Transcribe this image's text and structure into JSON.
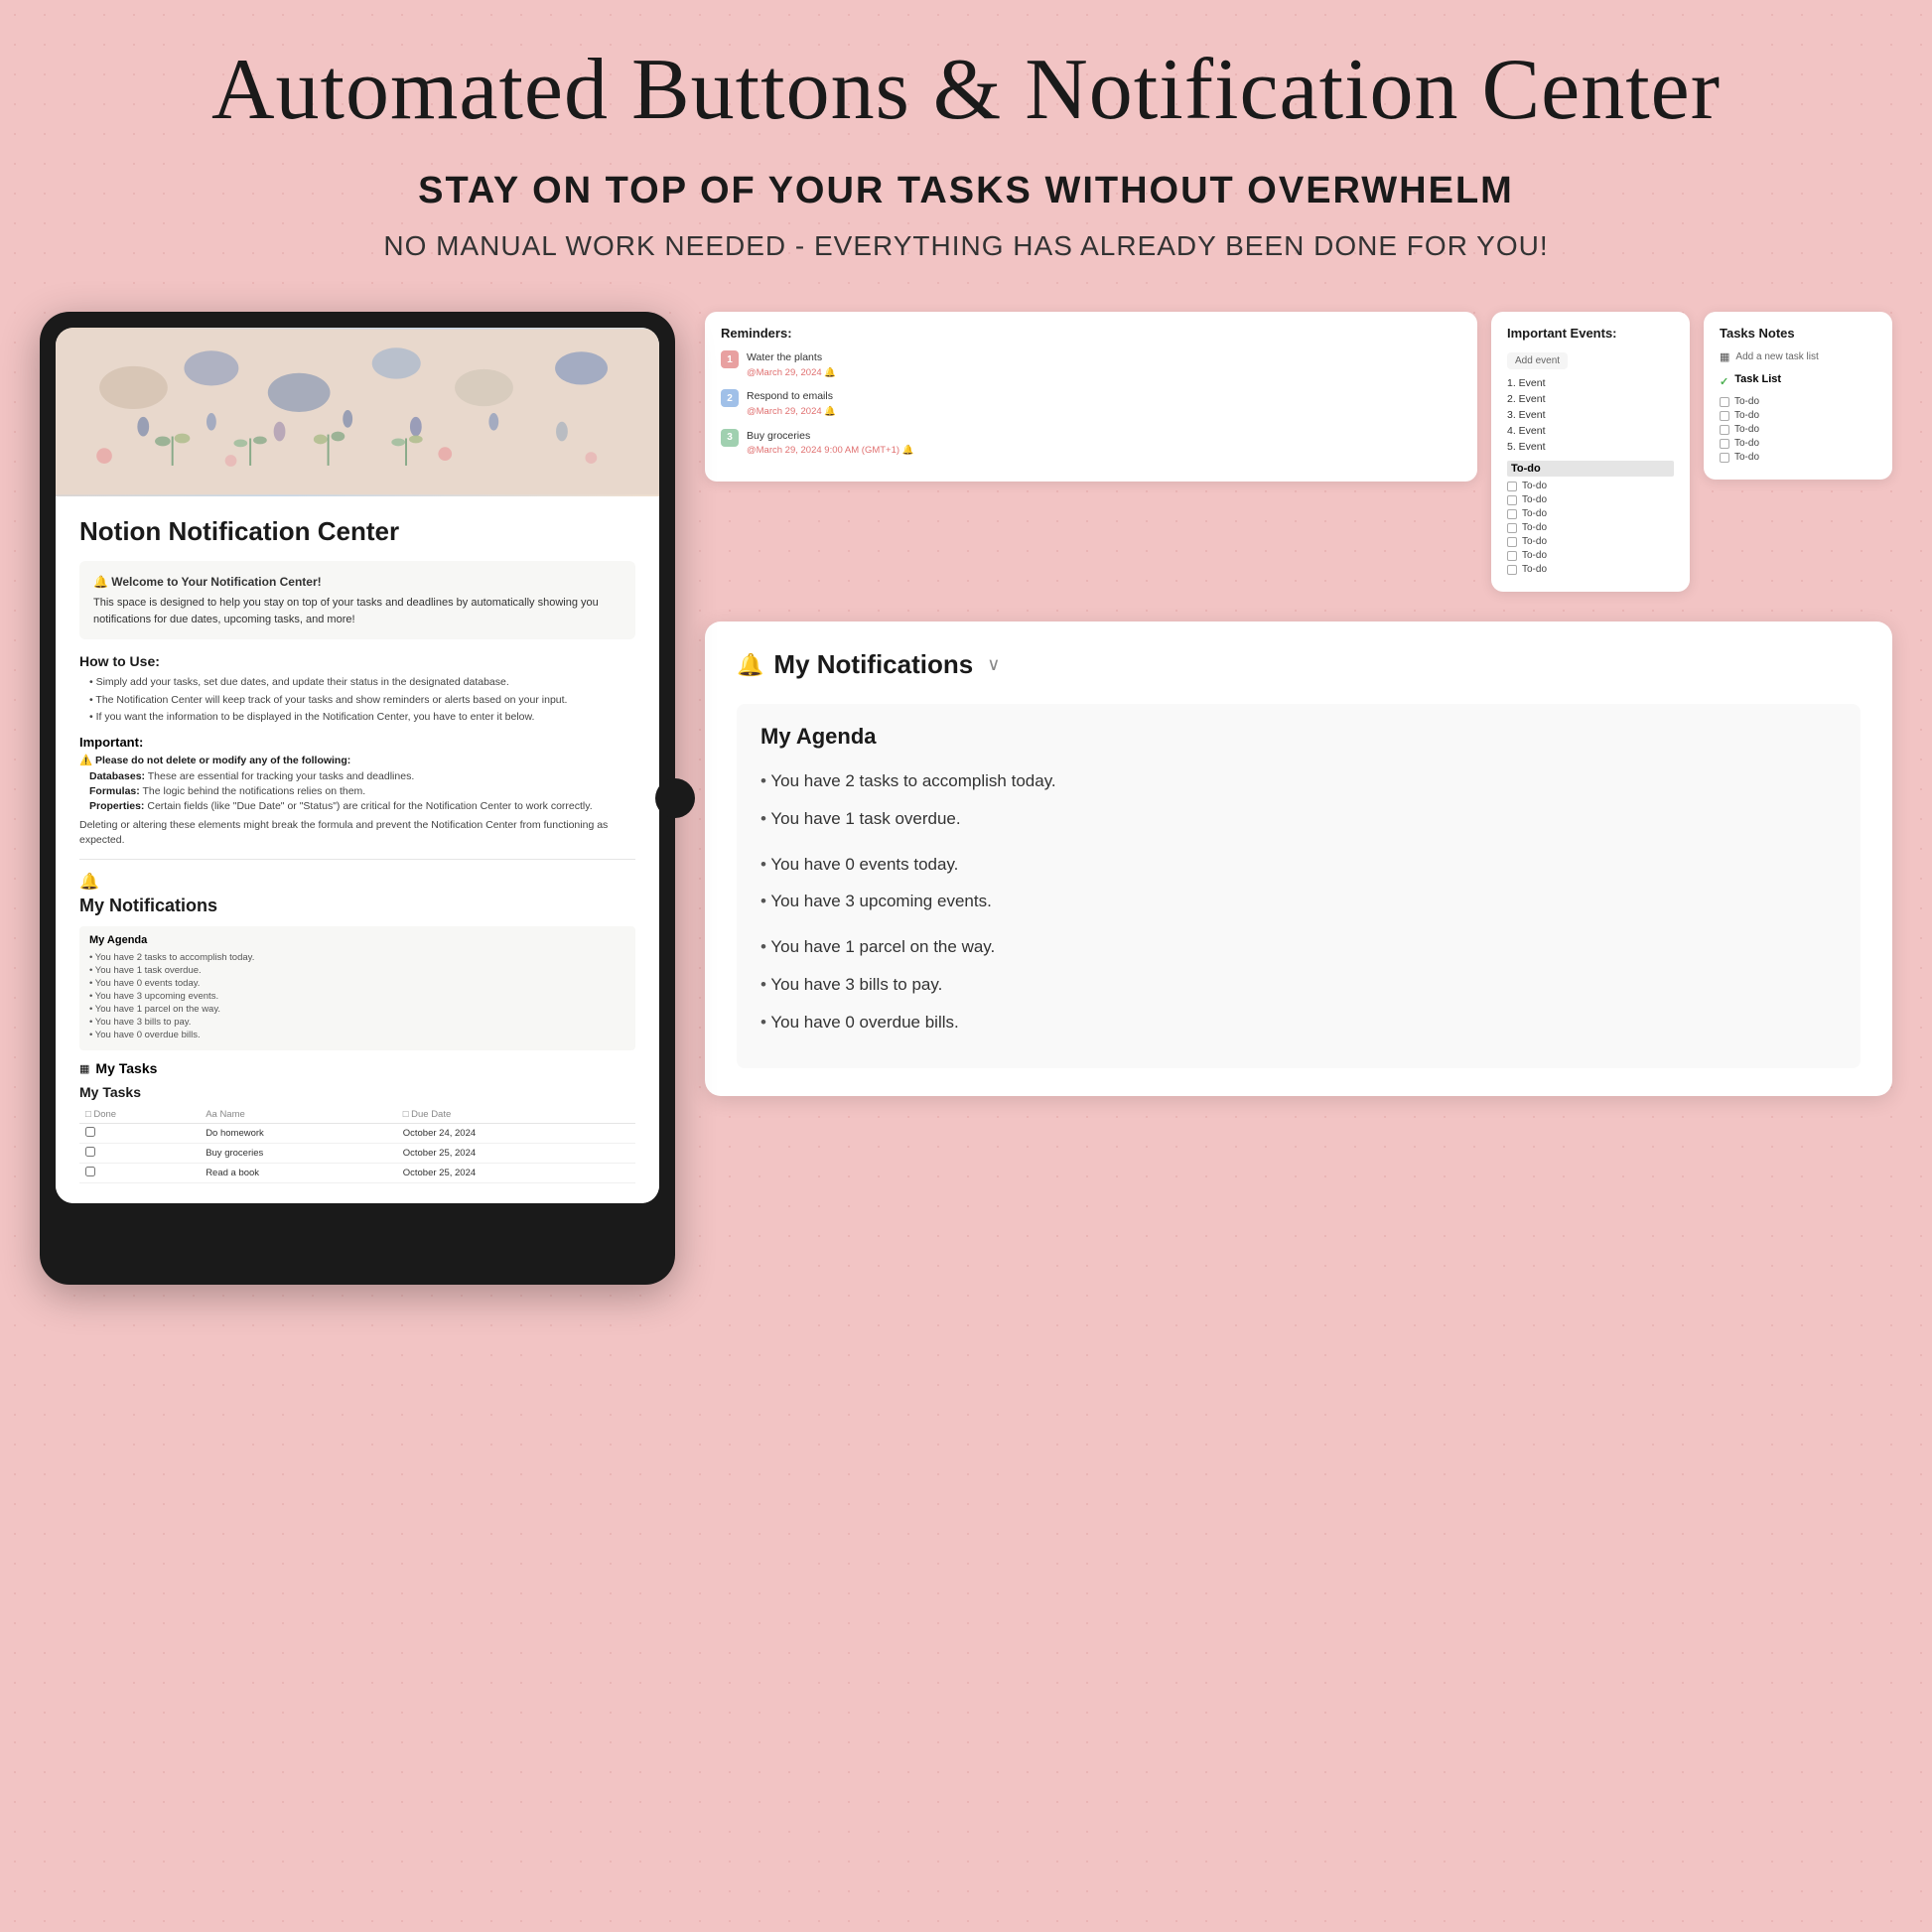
{
  "page": {
    "title": "Automated Buttons & Notification Center",
    "subtitle1": "STAY ON TOP OF YOUR TASKS WITHOUT OVERWHELM",
    "subtitle2": "NO MANUAL WORK NEEDED - EVERYTHING HAS ALREADY BEEN DONE FOR YOU!"
  },
  "tablet": {
    "notion_title": "Notion Notification Center",
    "welcome_title": "🔔 Welcome to Your Notification Center!",
    "welcome_body": "This space is designed to help you stay on top of your tasks and deadlines by automatically showing you notifications for due dates, upcoming tasks, and more!",
    "how_to_use": "How to Use:",
    "bullets": [
      "Simply add your tasks, set due dates, and update their status in the designated database.",
      "The Notification Center will keep track of your tasks and show reminders or alerts based on your input.",
      "If you want the information to be displayed in the Notification Center, you have to enter it below."
    ],
    "important": "Important:",
    "warning": "⚠️ Please do not delete or modify any of the following:",
    "bold_bullets": [
      {
        "bold": "Databases:",
        "text": " These are essential for tracking your tasks and deadlines."
      },
      {
        "bold": "Formulas:",
        "text": " The logic behind the notifications relies on them."
      },
      {
        "bold": "Properties:",
        "text": " Certain fields (like \"Due Date\" or \"Status\") are critical for the Notification Center to work correctly."
      }
    ],
    "para": "Deleting or altering these elements might break the formula and prevent the Notification Center from functioning as expected.",
    "my_notifications": "My Notifications",
    "my_agenda": "My Agenda",
    "agenda_items": [
      "• You have 2 tasks to accomplish today.",
      "• You have 1 task overdue.",
      "",
      "• You have 0 events today.",
      "• You have 3 upcoming events.",
      "",
      "• You have 1 parcel on the way.",
      "• You have 3 bills to pay.",
      "• You have 0 overdue bills."
    ],
    "my_tasks_label": "My Tasks",
    "tasks_table": {
      "headers": [
        "Done",
        "Name",
        "Due Date"
      ],
      "rows": [
        {
          "done": false,
          "name": "Do homework",
          "due": "October 24, 2024"
        },
        {
          "done": false,
          "name": "Buy groceries",
          "due": "October 25, 2024"
        },
        {
          "done": false,
          "name": "Read a book",
          "due": "October 25, 2024"
        }
      ]
    }
  },
  "reminders_widget": {
    "title": "Reminders:",
    "items": [
      {
        "num": "1",
        "text": "Water the plants",
        "date": "@March 29, 2024 🔔"
      },
      {
        "num": "2",
        "text": "Respond to emails",
        "date": "@March 29, 2024 🔔"
      },
      {
        "num": "3",
        "text": "Buy groceries",
        "date": "@March 29, 2024 9:00 AM (GMT+1) 🔔"
      }
    ]
  },
  "events_widget": {
    "title": "Important Events:",
    "add_event": "Add event",
    "events": [
      "1.  Event",
      "2.  Event",
      "3.  Event",
      "4.  Event",
      "5.  Event"
    ],
    "todo_title": "To-do",
    "todo_items": [
      "To-do",
      "To-do",
      "To-do",
      "To-do",
      "To-do",
      "To-do",
      "To-do"
    ]
  },
  "tasks_notes_widget": {
    "title": "Tasks Notes",
    "add_label": "Add a new task list",
    "task_list_title": "Task List",
    "task_items": [
      "To-do",
      "To-do",
      "To-do",
      "To-do",
      "To-do"
    ]
  },
  "notifications_large": {
    "icon": "🔔",
    "title": "My Notifications",
    "chevron": "∨",
    "agenda_heading": "My Agenda",
    "bullets": [
      "You have 2 tasks to accomplish today.",
      "You have 1 task overdue.",
      "You have 0 events today.",
      "You have 3 upcoming events.",
      "You have 1 parcel on the way.",
      "You have 3 bills to pay.",
      "You have 0 overdue bills."
    ]
  },
  "colors": {
    "background": "#f2c4c4",
    "card_bg": "#ffffff",
    "dark": "#1a1a1a",
    "accent_red": "#e07070",
    "accent_blue": "#a0c0e8",
    "accent_green": "#a0d0b0"
  }
}
